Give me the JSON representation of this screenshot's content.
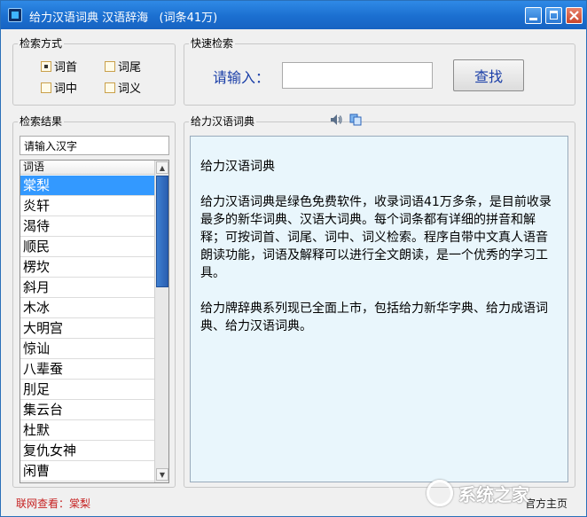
{
  "window": {
    "title": "给力汉语词典 汉语辞海   (词条41万)"
  },
  "search_mode": {
    "label": "检索方式",
    "options": [
      {
        "label": "词首",
        "checked": true
      },
      {
        "label": "词尾",
        "checked": false
      },
      {
        "label": "词中",
        "checked": false
      },
      {
        "label": "词义",
        "checked": false
      }
    ]
  },
  "quick_search": {
    "label": "快速检索",
    "prompt": "请输入：",
    "value": "",
    "button": "查找"
  },
  "results": {
    "label": "检索结果",
    "input_value": "请输入汉字",
    "column_header": "词语",
    "items": [
      "棠梨",
      "炎轩",
      "渴待",
      "顺民",
      "楞坎",
      "斜月",
      "木冰",
      "大明宫",
      "惊讪",
      "八辈蚕",
      "刖足",
      "集云台",
      "杜默",
      "复仇女神",
      "闲曹"
    ],
    "selected_index": 0
  },
  "dictionary": {
    "label": "给力汉语词典",
    "speaker_icon": "speaker-icon",
    "copy_icon": "copy-icon",
    "paragraphs": [
      "给力汉语词典",
      "给力汉语词典是绿色免费软件，收录词语41万多条，是目前收录最多的新华词典、汉语大词典。每个词条都有详细的拼音和解释；可按词首、词尾、词中、词义检索。程序自带中文真人语音朗读功能，词语及解释可以进行全文朗读，是一个优秀的学习工具。",
      "给力牌辞典系列现已全面上市，包括给力新华字典、给力成语词典、给力汉语词典。"
    ]
  },
  "status": {
    "online_lookup": "联网查看：棠梨",
    "official_site": "官方主页"
  },
  "watermark": {
    "text": "系统之家"
  },
  "colors": {
    "titlebar": "#1b6fd0",
    "selection": "#3399ff",
    "prompt_text": "#1b3fa8",
    "status_red": "#c62323",
    "text_bg": "#e9f6fc"
  }
}
